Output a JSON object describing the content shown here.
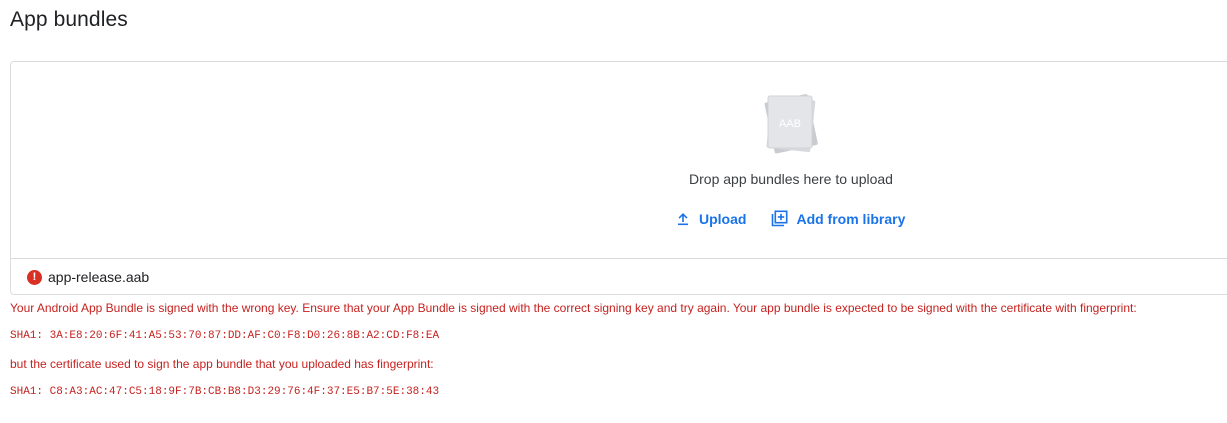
{
  "page": {
    "title": "App bundles"
  },
  "upload": {
    "file_icon_label": "AAB",
    "drop_text": "Drop app bundles here to upload",
    "upload_label": "Upload",
    "add_from_library_label": "Add from library"
  },
  "file": {
    "name": "app-release.aab",
    "status": "error",
    "error_icon_glyph": "!"
  },
  "error": {
    "message": "Your Android App Bundle is signed with the wrong key. Ensure that your App Bundle is signed with the correct signing key and try again. Your app bundle is expected to be signed with the certificate with fingerprint:",
    "expected_fingerprint": "SHA1: 3A:E8:20:6F:41:A5:53:70:87:DD:AF:C0:F8:D0:26:8B:A2:CD:F8:EA",
    "uploaded_intro": "but the certificate used to sign the app bundle that you uploaded has fingerprint:",
    "uploaded_fingerprint": "SHA1: C8:A3:AC:47:C5:18:9F:7B:CB:B8:D3:29:76:4F:37:E5:B7:5E:38:43"
  },
  "colors": {
    "link": "#1a73e8",
    "error": "#c5221f",
    "error_icon": "#d93025",
    "border": "#dadce0"
  }
}
